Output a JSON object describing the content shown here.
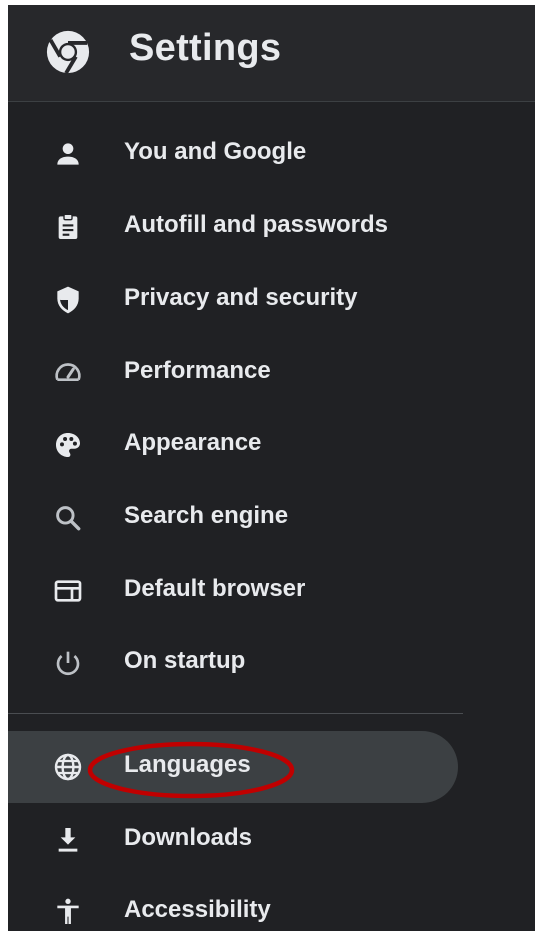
{
  "header": {
    "title": "Settings",
    "logo_icon": "chrome-logo-icon"
  },
  "menu": {
    "items": [
      {
        "label": "You and Google",
        "icon": "person-icon"
      },
      {
        "label": "Autofill and passwords",
        "icon": "clipboard-icon"
      },
      {
        "label": "Privacy and security",
        "icon": "shield-icon"
      },
      {
        "label": "Performance",
        "icon": "speedometer-icon"
      },
      {
        "label": "Appearance",
        "icon": "palette-icon"
      },
      {
        "label": "Search engine",
        "icon": "search-icon"
      },
      {
        "label": "Default browser",
        "icon": "browser-window-icon"
      },
      {
        "label": "On startup",
        "icon": "power-icon"
      },
      {
        "label": "Languages",
        "icon": "globe-icon",
        "active": true
      },
      {
        "label": "Downloads",
        "icon": "download-icon"
      },
      {
        "label": "Accessibility",
        "icon": "accessibility-icon"
      }
    ]
  },
  "annotation": {
    "type": "highlight-ellipse",
    "target": "Languages",
    "color": "#c00000"
  },
  "colors": {
    "background": "#202124",
    "header_background": "#27282b",
    "active_background": "#3c4043",
    "text": "#e8eaed",
    "icon": "#e8eaed",
    "muted_icon": "#bdc1c6"
  }
}
